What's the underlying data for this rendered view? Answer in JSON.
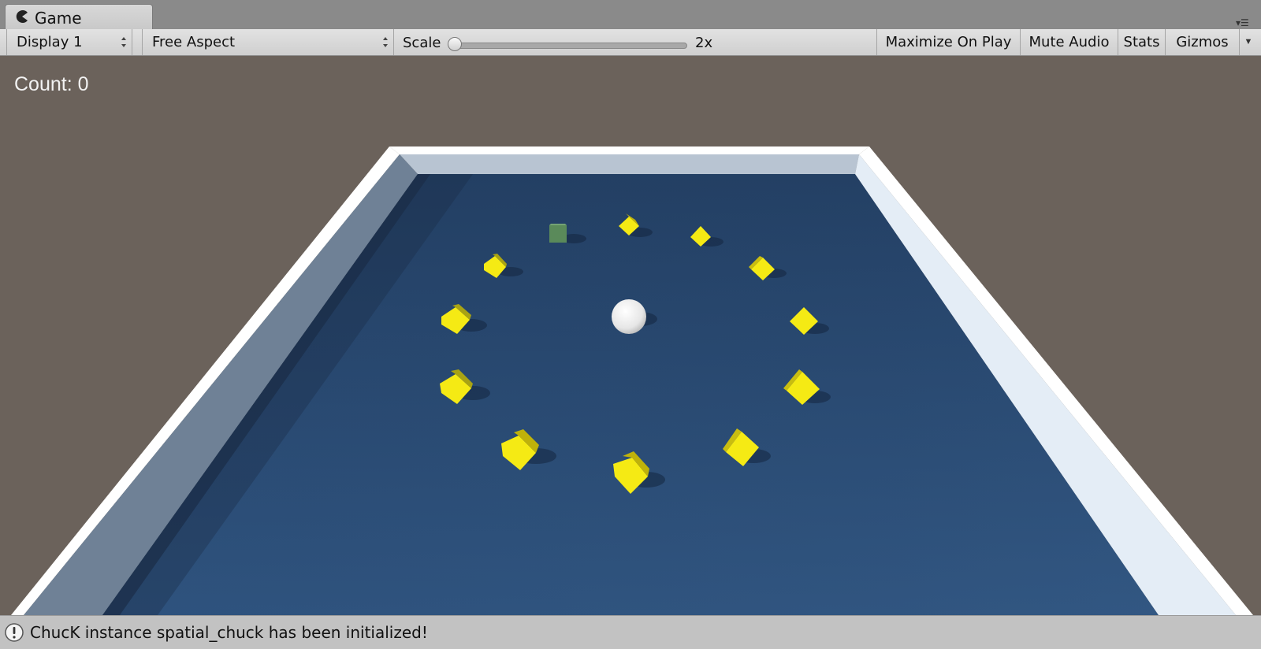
{
  "tab": {
    "title": "Game",
    "icon": "pacman-icon"
  },
  "toolbar": {
    "display": "Display 1",
    "aspect": "Free Aspect",
    "scale_label": "Scale",
    "scale_value": "2x",
    "scale_level": 0.0,
    "maximize_on_play": "Maximize On Play",
    "mute_audio": "Mute Audio",
    "stats": "Stats",
    "gizmos": "Gizmos"
  },
  "game": {
    "count_text": "Count: 0",
    "colors": {
      "background": "#6b625b",
      "floor": "#2b4a70",
      "wall": "#eef3f8",
      "pickup": "#f5ea14",
      "pickup_collected": "#5a8a5a",
      "player": "#f2f2f2"
    }
  },
  "status": {
    "message": "ChucK instance spatial_chuck has been initialized!",
    "icon": "info-icon"
  }
}
